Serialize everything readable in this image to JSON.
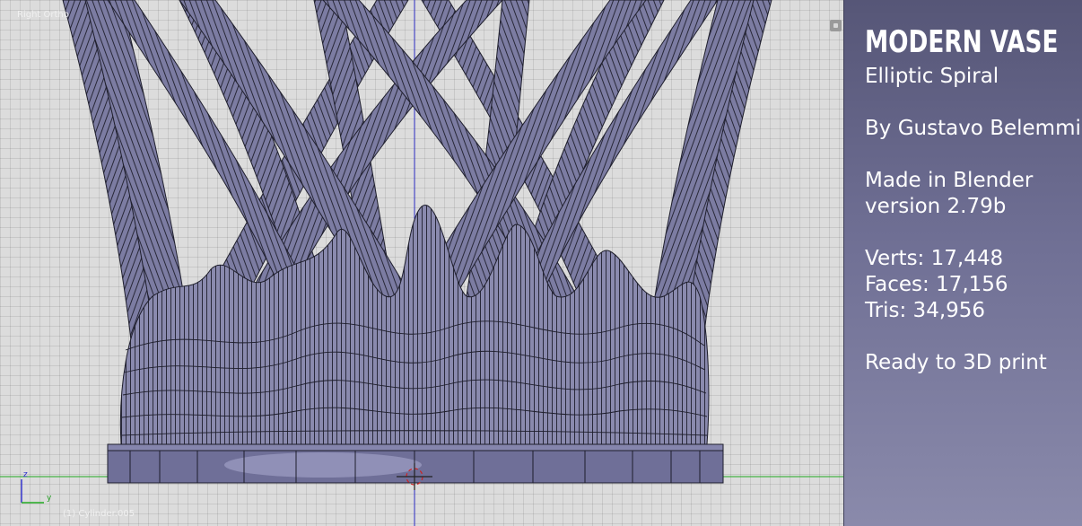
{
  "viewport": {
    "view_name": "Right Ortho",
    "object_name": "(1) Cylinder.005",
    "axes": {
      "vertical": "z",
      "horizontal": "y"
    }
  },
  "colors": {
    "mesh_fill": "#8a8aae",
    "mesh_wire": "#202030",
    "grid_bg": "#dcdcdc",
    "axis_green": "#22aa22",
    "axis_blue": "#3333cc",
    "panel_top": "#565677",
    "panel_bottom": "#8a8aab"
  },
  "info_panel": {
    "title": "MODERN VASE",
    "subtitle": "Elliptic Spiral",
    "author": "By Gustavo Belemmi",
    "made_in": "Made in Blender",
    "version": "version 2.79b",
    "verts": "Verts: 17,448",
    "faces": "Faces: 17,156",
    "tris": "Tris: 34,956",
    "print_note": "Ready to 3D print"
  }
}
